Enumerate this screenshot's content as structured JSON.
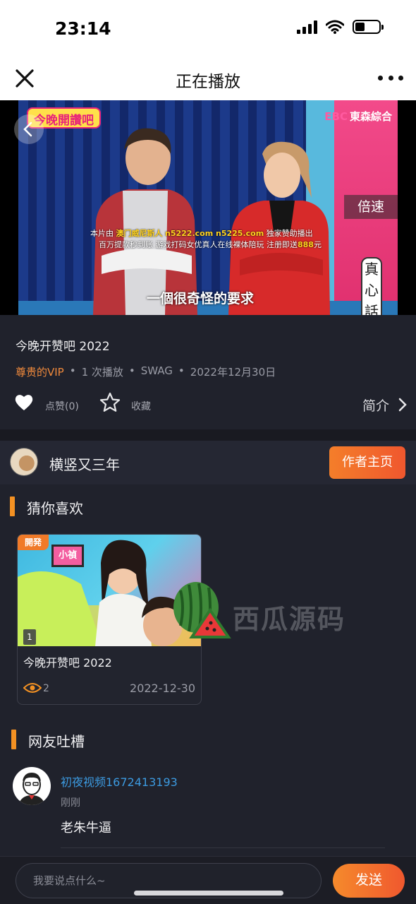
{
  "status_bar": {
    "time": "23:14",
    "battery_level": 0.4
  },
  "header": {
    "title": "正在播放",
    "close_icon": "close-icon",
    "more_icon": "more-icon"
  },
  "video": {
    "show_logo": "今晚開讚吧",
    "channel_prefix": "EBC",
    "channel": "東森綜合",
    "ad_line1_a": "本片由",
    "ad_line1_b": "澳门威尼斯人",
    "ad_line1_c": "n5222.com  n5225.com",
    "ad_line1_d": "独家赞助播出",
    "ad_line2_a": "百万提款秒到账 游戏打码女优真人在线裸体陪玩 注册即送",
    "ad_line2_b": "888",
    "ad_line2_c": "元",
    "subtitle": "一個很奇怪的要求",
    "side_caption": "真心話時間",
    "speed_label": "倍速"
  },
  "info": {
    "title": "今晚开赞吧 2022",
    "vip": "尊贵的VIP",
    "plays": "1 次播放",
    "uploader": "SWAG",
    "date": "2022年12月30日",
    "like_label": "点赞(0)",
    "favorite_label": "收藏",
    "intro_label": "简介"
  },
  "author": {
    "name": "横竖又三年",
    "button_label": "作者主页"
  },
  "recommend": {
    "section_title": "猜你喜欢",
    "items": [
      {
        "badge": "開発",
        "sign": "小禎",
        "episode": "1",
        "title": "今晚开赞吧 2022",
        "views": "2",
        "date": "2022-12-30"
      }
    ]
  },
  "watermark": {
    "text": "西瓜源码"
  },
  "comments": {
    "section_title": "网友吐槽",
    "items": [
      {
        "user": "初夜视频1672413193",
        "time": "刚刚",
        "text": "老朱牛逼"
      }
    ]
  },
  "input_bar": {
    "placeholder": "我要说点什么~",
    "send_label": "发送"
  },
  "colors": {
    "accent": "#f39123",
    "link": "#3c9ae0",
    "vip": "#f08a3c"
  }
}
